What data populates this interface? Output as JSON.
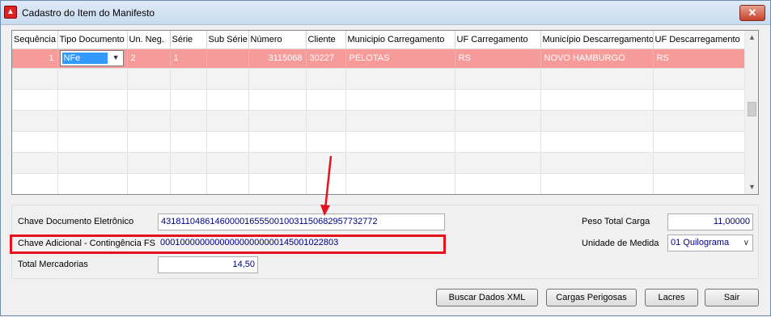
{
  "window": {
    "title": "Cadastro do Item do Manifesto",
    "close_label": "✕"
  },
  "grid": {
    "columns": [
      "Sequência",
      "Tipo Documento",
      "Un. Neg.",
      "Série",
      "Sub Série",
      "Número",
      "Cliente",
      "Municipio Carregamento",
      "UF Carregamento",
      "Município Descarregamento",
      "UF Descarregamento"
    ],
    "selected_row": {
      "sequencia": "1",
      "tipo_documento": "NFe",
      "un_neg": "2",
      "serie": "1",
      "sub_serie": "",
      "numero": "3115068",
      "cliente": "30227",
      "municipio_carregamento": "PELOTAS",
      "uf_carregamento": "RS",
      "municipio_descarregamento": "NOVO HAMBURGO",
      "uf_descarregamento": "RS"
    },
    "empty_rows": 6
  },
  "form": {
    "chave_documento_label": "Chave Documento Eletrônico",
    "chave_documento_value": "43181104861460000165550010031150682957732772",
    "chave_adicional_label": "Chave Adicional - Contingência FS",
    "chave_adicional_value": "000100000000000000000000145001022803",
    "total_mercadorias_label": "Total Mercadorias",
    "total_mercadorias_value": "14,50",
    "peso_total_label": "Peso Total Carga",
    "peso_total_value": "11,00000",
    "unidade_medida_label": "Unidade de Medida",
    "unidade_medida_value": "01 Quilograma"
  },
  "buttons": {
    "buscar_xml": "Buscar Dados XML",
    "cargas_perigosas": "Cargas Perigosas",
    "lacres": "Lacres",
    "sair": "Sair"
  },
  "colors": {
    "selected_row": "#f79a9a",
    "highlight": "#e5131d",
    "field_text": "#000080"
  },
  "icons": {
    "app": "app-icon",
    "close": "close-icon",
    "dropdown": "chevron-down-icon",
    "scroll_up": "scroll-up-icon",
    "scroll_down": "scroll-down-icon"
  }
}
